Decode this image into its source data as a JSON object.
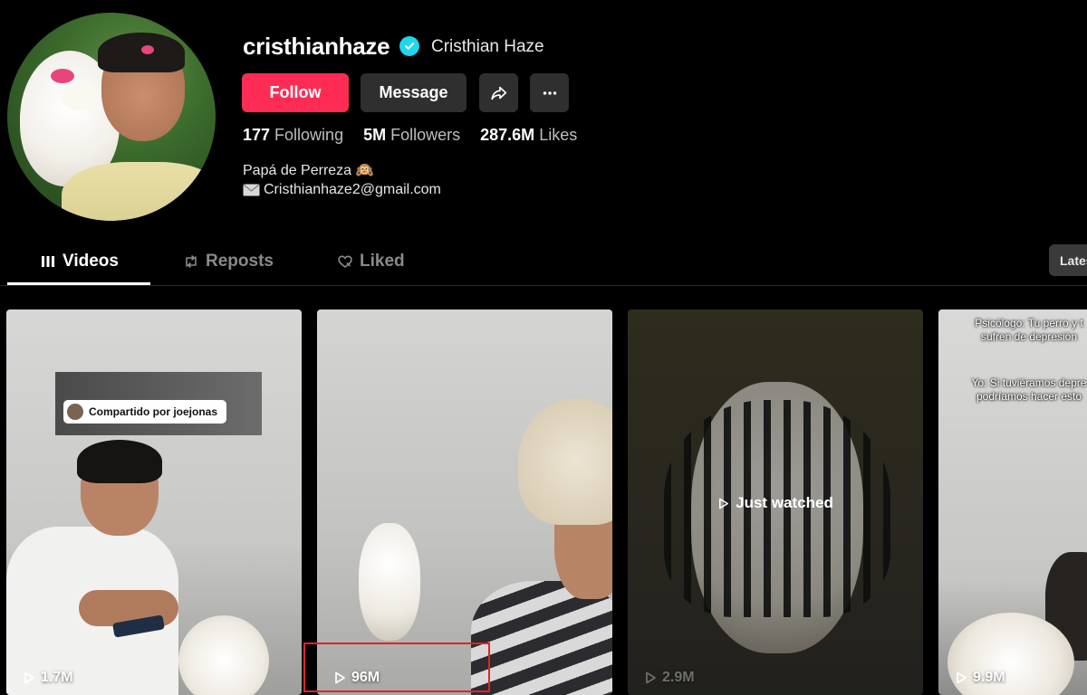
{
  "profile": {
    "username": "cristhianhaze",
    "nickname": "Cristhian Haze",
    "verified": true,
    "bio_line1": "Papá de Perreza 🙉",
    "bio_email": "Cristhianhaze2@gmail.com"
  },
  "actions": {
    "follow_label": "Follow",
    "message_label": "Message",
    "share_icon": "share-arrow-icon",
    "more_icon": "ellipsis-icon"
  },
  "stats": [
    {
      "value": "177",
      "label": "Following"
    },
    {
      "value": "5M",
      "label": "Followers"
    },
    {
      "value": "287.6M",
      "label": "Likes"
    }
  ],
  "tabs": [
    {
      "label": "Videos",
      "icon": "grid-icon",
      "active": true
    },
    {
      "label": "Reposts",
      "icon": "repost-icon",
      "active": false
    },
    {
      "label": "Liked",
      "icon": "liked-icon",
      "active": false
    }
  ],
  "sort": {
    "label": "Lates"
  },
  "videos": [
    {
      "views": "1.7M",
      "overlay": "Compartido por joejonas"
    },
    {
      "views": "96M"
    },
    {
      "views": "2.9M",
      "status": "Just watched"
    },
    {
      "views": "9.9M",
      "caption_1": "Psicólogo: Tu perro y t\nsufren de depresión",
      "caption_2": "Yo: Si tuviéramos depre\npodríamos hacer esto"
    }
  ],
  "colors": {
    "background": "#000000",
    "follow_button": "#fe2c55",
    "secondary_button": "#2f2f2f",
    "verified_badge": "#20d5ec",
    "highlight_box": "#e02424"
  }
}
